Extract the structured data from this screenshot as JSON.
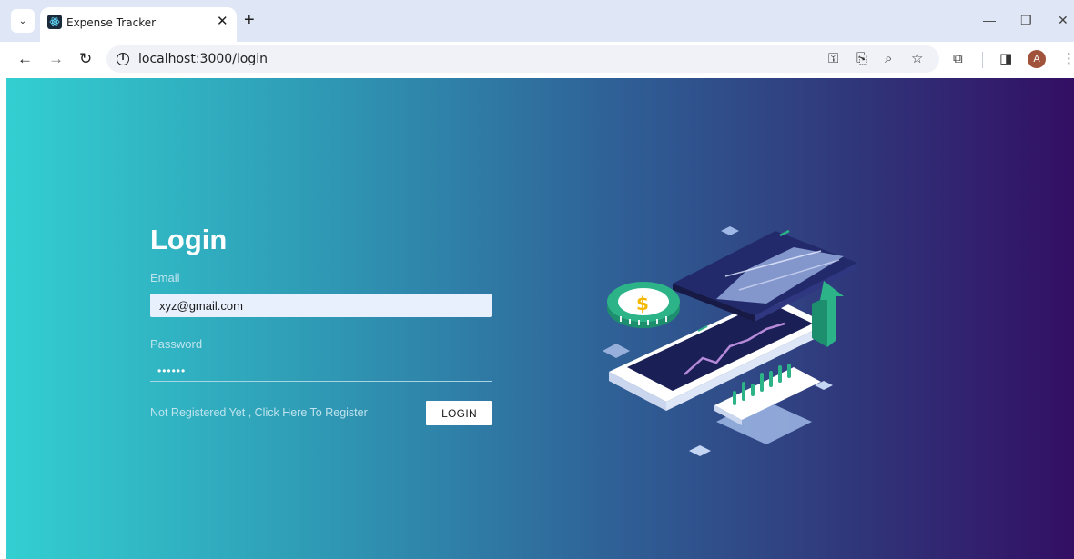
{
  "browser": {
    "tab_title": "Expense Tracker",
    "tab_close": "✕",
    "new_tab": "+",
    "tab_list_icon": "⌄",
    "url": "localhost:3000/login",
    "profile_initial": "A",
    "window_controls": {
      "minimize": "—",
      "restore": "❐",
      "close": "✕"
    }
  },
  "login": {
    "heading": "Login",
    "email_label": "Email",
    "email_value": "xyz@gmail.com",
    "password_label": "Password",
    "password_value": "••••••",
    "register_link": "Not Registered Yet , Click Here To Register",
    "login_button": "LOGIN"
  },
  "illustration": {
    "currency_symbol": "$"
  },
  "colors": {
    "gradient_start": "#33cfd1",
    "gradient_end": "#330f64",
    "accent_green": "#2db388"
  }
}
